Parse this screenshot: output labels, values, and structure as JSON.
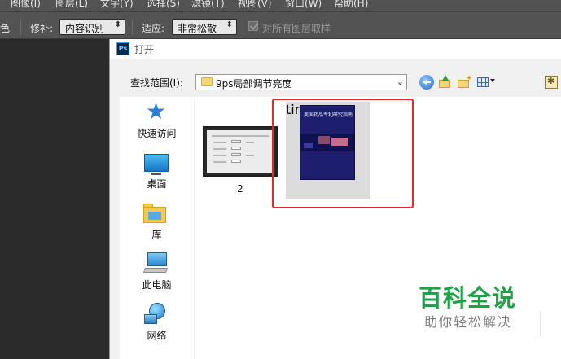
{
  "menubar": {
    "items": [
      "图像(I)",
      "图层(L)",
      "文字(Y)",
      "选择(S)",
      "滤镜(T)",
      "视图(V)",
      "窗口(W)",
      "帮助(H)"
    ]
  },
  "options_bar": {
    "left_fragment": "色",
    "patch_label": "修补:",
    "patch_value": "内容识别",
    "adapt_label": "适应:",
    "adapt_value": "非常松散",
    "sample_all_label": "对所有图层取样",
    "sample_all_checked": true
  },
  "dialog": {
    "title": "打开",
    "app_icon_text": "Ps",
    "look_in_label": "查找范围(I):",
    "look_in_value": "9ps局部调节亮度",
    "toolbar_icons": [
      "back-icon",
      "up-folder-icon",
      "new-folder-icon",
      "view-menu-icon",
      "preview-icon"
    ],
    "places": [
      {
        "label": "快速访问",
        "icon": "quick-access-icon"
      },
      {
        "label": "桌面",
        "icon": "desktop-icon"
      },
      {
        "label": "库",
        "icon": "libraries-icon"
      },
      {
        "label": "此电脑",
        "icon": "this-pc-icon"
      },
      {
        "label": "网络",
        "icon": "network-icon"
      }
    ],
    "files": [
      {
        "name": "2",
        "selected": false
      },
      {
        "name": "timg",
        "selected": true
      }
    ],
    "cover_title": "美国药品专利研究指南",
    "highlight_color": "#e4282a"
  },
  "watermark": {
    "title": "百科全说",
    "subtitle": "助你轻松解决",
    "color": "#21a145"
  }
}
